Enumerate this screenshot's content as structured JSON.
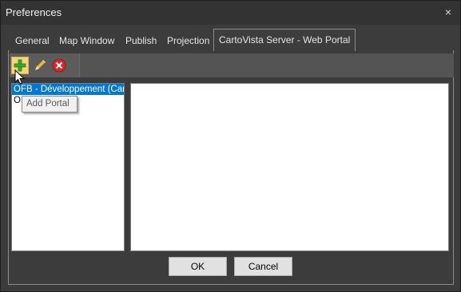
{
  "window": {
    "title": "Preferences",
    "close_label": "×"
  },
  "tabs": [
    {
      "label": "General"
    },
    {
      "label": "Map Window"
    },
    {
      "label": "Publish"
    },
    {
      "label": "Projection"
    },
    {
      "label": "CartoVista Server - Web Portal"
    }
  ],
  "active_tab": "CartoVista Server - Web Portal",
  "toolbar": {
    "add_icon": "add-icon",
    "edit_icon": "pencil-icon",
    "delete_icon": "delete-icon"
  },
  "portals": [
    {
      "label": "OFB - Développement (Carto"
    },
    {
      "label": "O           BRGM)"
    }
  ],
  "tooltip": {
    "text": "Add Portal"
  },
  "buttons": {
    "ok": "OK",
    "cancel": "Cancel"
  }
}
